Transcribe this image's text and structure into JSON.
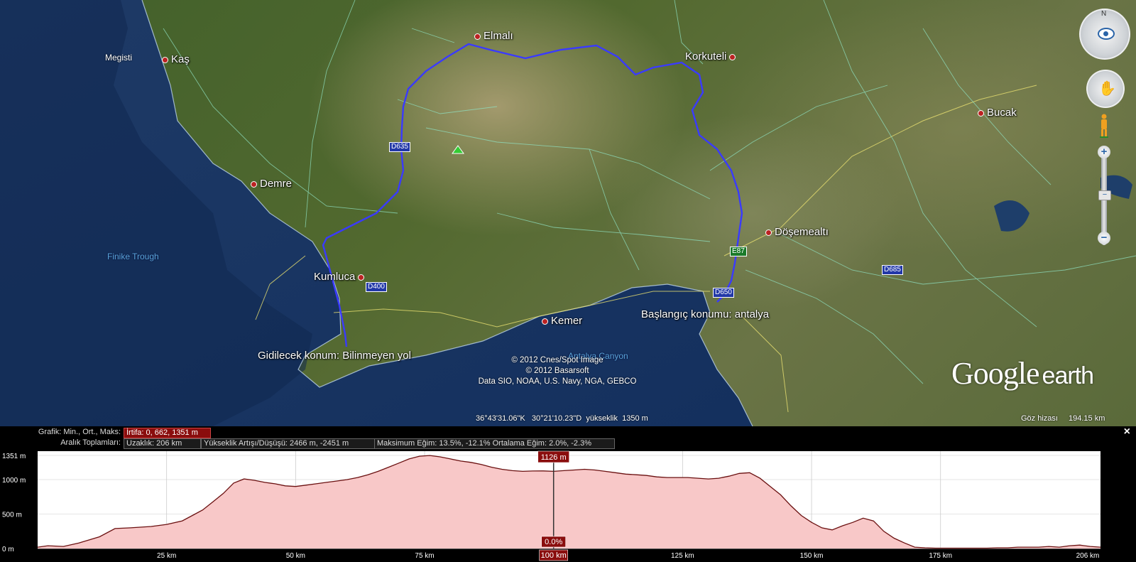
{
  "map": {
    "places": [
      {
        "id": "kas",
        "label": "Kaş"
      },
      {
        "id": "elmali",
        "label": "Elmalı"
      },
      {
        "id": "korkuteli",
        "label": "Korkuteli"
      },
      {
        "id": "bucak",
        "label": "Bucak"
      },
      {
        "id": "demre",
        "label": "Demre"
      },
      {
        "id": "dosemealti",
        "label": "Döşemealtı"
      },
      {
        "id": "kumluca",
        "label": "Kumluca"
      },
      {
        "id": "kemer",
        "label": "Kemer"
      }
    ],
    "megisti": "Megisti",
    "sea_labels": {
      "finike": "Finike Trough",
      "antalya_canyon": "Antalya Canyon"
    },
    "start_label": "Başlangıç konumu: antalya",
    "destination_label": "Gidilecek konum: Bilinmeyen yol",
    "road_shields": {
      "d635": "D635",
      "e87": "E87",
      "d685": "D685",
      "d650": "D650",
      "d400": "D400"
    },
    "copyright": [
      "© 2012 Cnes/Spot Image",
      "© 2012 Basarsoft",
      "Data SIO, NOAA, U.S. Navy, NGA, GEBCO"
    ],
    "logo": {
      "main": "Google",
      "sub": "earth"
    },
    "status": {
      "coords": "36°43'31.06\"K   30°21'10.23\"D  yükseklik  1350 m",
      "eye_alt_label": "Göz hizası",
      "eye_alt_value": "194.15 km"
    },
    "nav": {
      "north": "N",
      "zoom_in": "+",
      "zoom_out": "−",
      "zoom_handle": "−"
    },
    "route_color": "#3a3aff"
  },
  "elevation_panel": {
    "close": "×",
    "graph_label": "Grafik: Min., Ort., Maks:",
    "elevation_stat": "İrtifa: 0, 662, 1351 m",
    "totals_label": "Aralık Toplamları:",
    "distance_stat": "Uzaklık: 206 km",
    "gain_loss_stat": "Yükseklik Artışı/Düşüşü: 2466 m, -2451 m",
    "slope_stat": "Maksimum Eğim: 13.5%, -12.1% Ortalama Eğim: 2.0%, -2.3%",
    "cursor_elevation": "1126 m",
    "cursor_slope": "0.0%",
    "cursor_distance": "100 km"
  },
  "chart_data": {
    "type": "area",
    "xlabel": "",
    "ylabel": "",
    "xlim": [
      0,
      206
    ],
    "ylim": [
      0,
      1351
    ],
    "y_ticks": [
      {
        "value": 0,
        "label": "0 m"
      },
      {
        "value": 500,
        "label": "500 m"
      },
      {
        "value": 1000,
        "label": "1000 m"
      },
      {
        "value": 1351,
        "label": "1351 m"
      }
    ],
    "x_ticks": [
      {
        "value": 25,
        "label": "25 km"
      },
      {
        "value": 50,
        "label": "50 km"
      },
      {
        "value": 75,
        "label": "75 km"
      },
      {
        "value": 100,
        "label": "100 km"
      },
      {
        "value": 125,
        "label": "125 km"
      },
      {
        "value": 150,
        "label": "150 km"
      },
      {
        "value": 175,
        "label": "175 km"
      },
      {
        "value": 206,
        "label": "206 km"
      }
    ],
    "cursor_x": 100,
    "grid": true,
    "fill_color": "#f8c8c8",
    "line_color": "#6a1010",
    "series": [
      {
        "x": [
          0,
          2,
          5,
          8,
          12,
          15,
          18,
          22,
          25,
          28,
          30,
          32,
          34,
          36,
          38,
          40,
          42,
          44,
          46,
          48,
          50,
          52,
          54,
          56,
          58,
          60,
          62,
          64,
          66,
          68,
          70,
          72,
          74,
          76,
          78,
          80,
          82,
          84,
          86,
          88,
          90,
          92,
          94,
          96,
          98,
          100,
          102,
          104,
          106,
          108,
          110,
          112,
          114,
          116,
          118,
          120,
          122,
          124,
          126,
          128,
          130,
          132,
          134,
          136,
          138,
          140,
          142,
          144,
          146,
          148,
          150,
          152,
          154,
          156,
          158,
          160,
          162,
          164,
          166,
          168,
          170,
          172,
          174,
          176,
          178,
          180,
          182,
          184,
          186,
          188,
          190,
          192,
          194,
          196,
          198,
          200,
          202,
          204,
          206
        ],
        "y": [
          20,
          40,
          30,
          80,
          170,
          290,
          300,
          320,
          350,
          400,
          480,
          560,
          680,
          800,
          950,
          1010,
          990,
          960,
          940,
          910,
          900,
          920,
          940,
          960,
          980,
          1000,
          1030,
          1070,
          1120,
          1180,
          1240,
          1300,
          1340,
          1350,
          1330,
          1300,
          1270,
          1250,
          1220,
          1180,
          1150,
          1130,
          1120,
          1125,
          1126,
          1120,
          1130,
          1140,
          1150,
          1140,
          1120,
          1100,
          1080,
          1070,
          1060,
          1040,
          1030,
          1030,
          1030,
          1020,
          1010,
          1020,
          1050,
          1090,
          1100,
          1020,
          900,
          780,
          620,
          480,
          380,
          300,
          270,
          330,
          380,
          440,
          400,
          250,
          150,
          80,
          20,
          10,
          5,
          5,
          5,
          5,
          5,
          5,
          10,
          10,
          20,
          20,
          20,
          30,
          20,
          40,
          50,
          30,
          20
        ]
      }
    ]
  }
}
